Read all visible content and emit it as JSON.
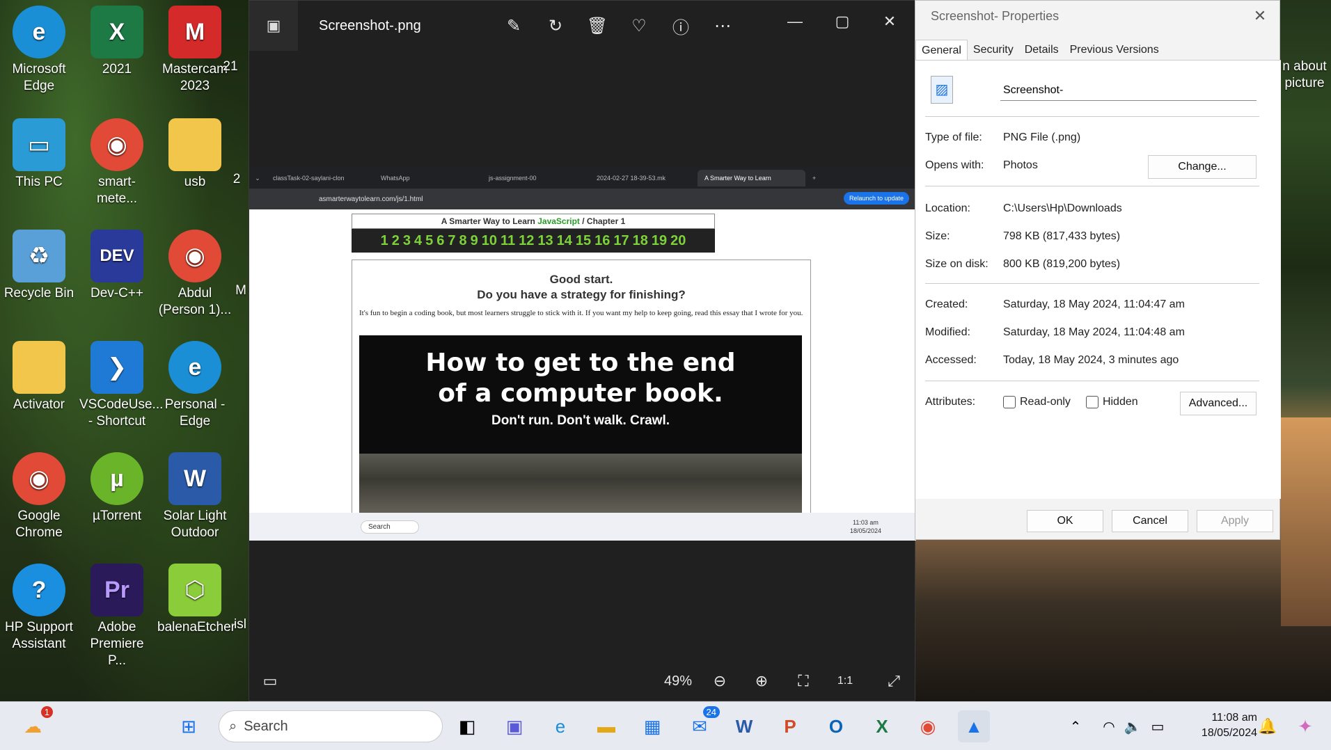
{
  "desktop": {
    "icons": [
      {
        "label": "Microsoft Edge",
        "icon": "edge-icon",
        "color": "#1a8fd6"
      },
      {
        "label": "2021",
        "icon": "excel-icon",
        "color": "#1d7a45"
      },
      {
        "label": "Mastercam 2023",
        "icon": "mastercam-icon",
        "color": "#d42a2a"
      },
      {
        "label": "This PC",
        "icon": "monitor-icon",
        "color": "#2b9bd6"
      },
      {
        "label": "smart-mete...",
        "icon": "chrome-icon",
        "color": "#e04a36"
      },
      {
        "label": "usb",
        "icon": "folder-icon",
        "color": "#f2c64a"
      },
      {
        "label": "Recycle Bin",
        "icon": "recycle-bin-icon",
        "color": "#5aa0d8"
      },
      {
        "label": "Dev-C++",
        "icon": "devcpp-icon",
        "color": "#2a3a9a"
      },
      {
        "label": "Abdul (Person 1)...",
        "icon": "chrome-icon",
        "color": "#e04a36"
      },
      {
        "label": "Activator",
        "icon": "folder-icon",
        "color": "#f2c64a"
      },
      {
        "label": "VSCodeUse... - Shortcut",
        "icon": "vscode-icon",
        "color": "#1f7ad6"
      },
      {
        "label": "Personal - Edge",
        "icon": "edge-icon",
        "color": "#1a8fd6"
      },
      {
        "label": "Google Chrome",
        "icon": "chrome-icon",
        "color": "#e04a36"
      },
      {
        "label": "µTorrent",
        "icon": "utorrent-icon",
        "color": "#6ab42a"
      },
      {
        "label": "Solar Light Outdoor",
        "icon": "word-icon",
        "color": "#2a5aa8"
      },
      {
        "label": "HP Support Assistant",
        "icon": "help-icon",
        "color": "#1a8fe0"
      },
      {
        "label": "Adobe Premiere P...",
        "icon": "premiere-icon",
        "color": "#2a1a5a"
      },
      {
        "label": "balenaEtcher",
        "icon": "cube-icon",
        "color": "#8acc3a"
      }
    ],
    "partial_labels": [
      "21",
      "2",
      "M",
      "isl"
    ],
    "right_labels": [
      "n about",
      "picture"
    ]
  },
  "viewer": {
    "filename": "Screenshot-.png",
    "zoom": "49%",
    "toolbar": [
      "edit-icon",
      "rotate-icon",
      "delete-icon",
      "favorite-icon",
      "info-icon",
      "more-icon"
    ]
  },
  "browser": {
    "tabs": [
      "classTask-02-saylani-clon",
      "WhatsApp",
      "js-assignment-00",
      "2024-02-27 18-39-53.mk",
      "A Smarter Way to Learn"
    ],
    "url": "asmarterwaytolearn.com/js/1.html",
    "relaunch": "Relaunch to update"
  },
  "page": {
    "header_prefix": "A Smarter Way to Learn",
    "header_js": "JavaScript",
    "header_suffix": "/  Chapter 1",
    "chapters": [
      "1",
      "2",
      "3",
      "4",
      "5",
      "6",
      "7",
      "8",
      "9",
      "10",
      "11",
      "12",
      "13",
      "14",
      "15",
      "16",
      "17",
      "18",
      "19",
      "20"
    ],
    "heading1": "Good start.",
    "heading2": "Do you have a strategy for finishing?",
    "paragraph": "It's fun to begin a coding book, but most learners struggle to stick with it. If you want my help to keep going, read this essay that I wrote for you.",
    "banner_line1": "How to get to the end",
    "banner_line2": "of a computer book.",
    "banner_line3": "Don't run. Don't walk. Crawl."
  },
  "inner_taskbar": {
    "search": "Search",
    "time": "11:03 am",
    "date": "18/05/2024"
  },
  "properties": {
    "title": "Screenshot- Properties",
    "tabs": [
      "General",
      "Security",
      "Details",
      "Previous Versions"
    ],
    "name": "Screenshot-",
    "type_label": "Type of file:",
    "type_value": "PNG File (.png)",
    "opens_label": "Opens with:",
    "opens_value": "Photos",
    "change": "Change...",
    "location_label": "Location:",
    "location_value": "C:\\Users\\Hp\\Downloads",
    "size_label": "Size:",
    "size_value": "798 KB (817,433 bytes)",
    "disk_label": "Size on disk:",
    "disk_value": "800 KB (819,200 bytes)",
    "created_label": "Created:",
    "created_value": "Saturday, 18 May 2024, 11:04:47 am",
    "modified_label": "Modified:",
    "modified_value": "Saturday, 18 May 2024, 11:04:48 am",
    "accessed_label": "Accessed:",
    "accessed_value": "Today, 18 May 2024, 3 minutes ago",
    "attributes_label": "Attributes:",
    "readonly": "Read-only",
    "hidden": "Hidden",
    "advanced": "Advanced...",
    "ok": "OK",
    "cancel": "Cancel",
    "apply": "Apply"
  },
  "taskbar": {
    "search": "Search",
    "time": "11:08 am",
    "date": "18/05/2024",
    "weather_badge": "1",
    "mail_badge": "24"
  }
}
